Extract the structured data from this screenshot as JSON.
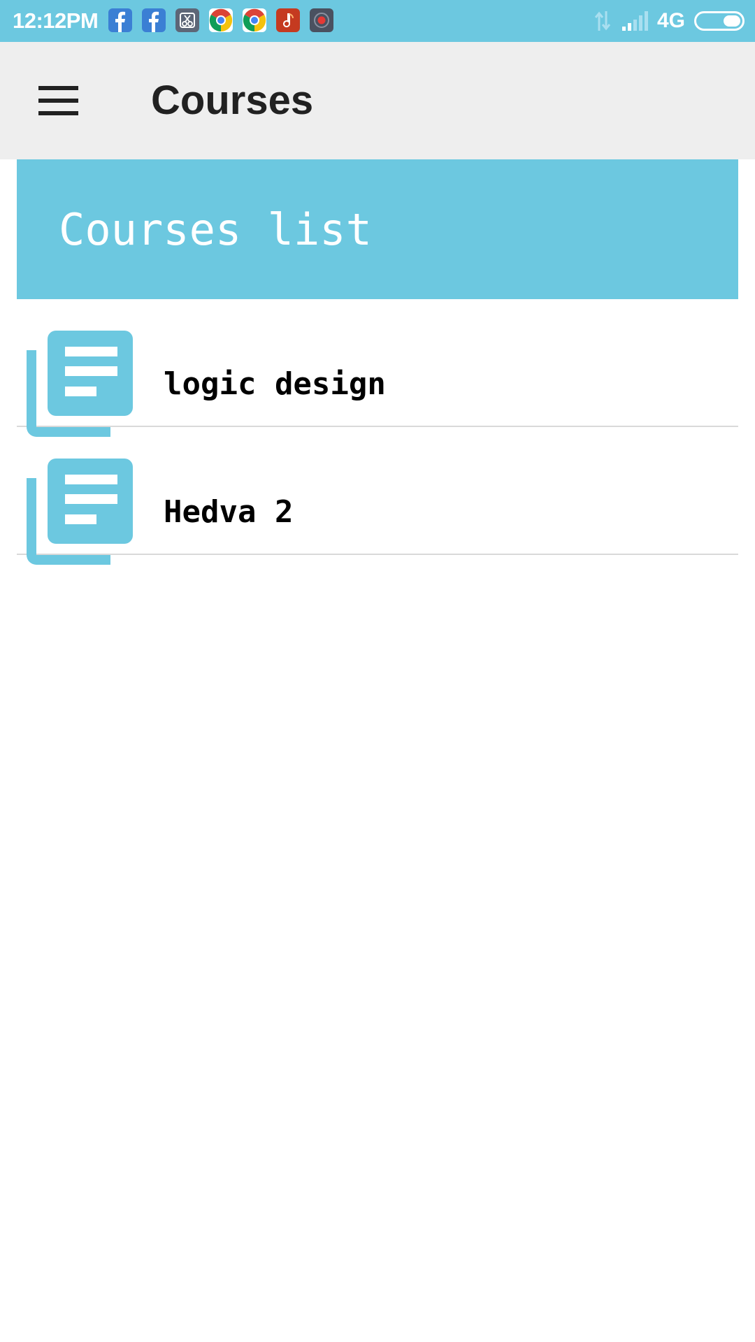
{
  "status_bar": {
    "time": "12:12PM",
    "network": "4G",
    "notification_icons": [
      "facebook-icon",
      "facebook-icon",
      "scissors-app-icon",
      "chrome-icon",
      "chrome-icon",
      "music-app-icon",
      "screen-recorder-icon"
    ],
    "colors": {
      "background": "#6cc8e0"
    }
  },
  "app_bar": {
    "title": "Courses",
    "menu_icon": "hamburger-menu-icon",
    "colors": {
      "background": "#eeeeee",
      "text": "#212121"
    }
  },
  "list_header": {
    "title": "Courses list",
    "colors": {
      "background": "#6cc8e0",
      "text": "#ffffff"
    }
  },
  "courses": [
    {
      "name": "logic design",
      "icon": "course-document-icon"
    },
    {
      "name": "Hedva 2",
      "icon": "course-document-icon"
    }
  ],
  "colors": {
    "accent": "#6cc8e0",
    "divider": "#d9d9d9"
  }
}
